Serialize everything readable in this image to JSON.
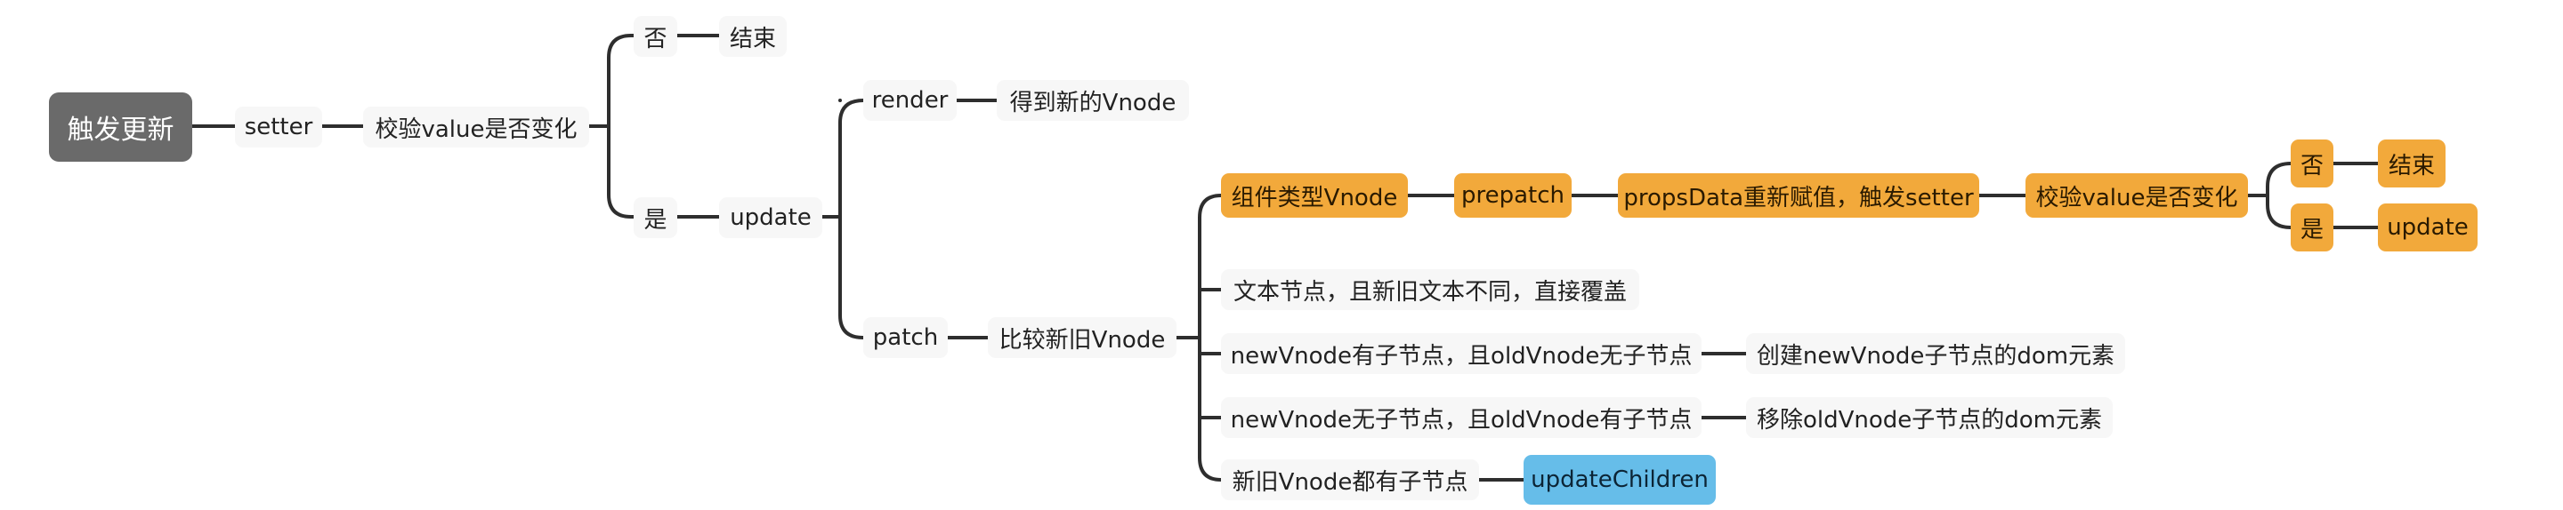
{
  "mindmap": {
    "root": "触发更新",
    "n_setter": "setter",
    "n_check1": "校验value是否变化",
    "n_no1": "否",
    "n_end1": "结束",
    "n_yes1": "是",
    "n_update1": "update",
    "n_render": "render",
    "n_newvnode": "得到新的Vnode",
    "n_patch": "patch",
    "n_compare": "比较新旧Vnode",
    "n_comp": "组件类型Vnode",
    "n_prepatch": "prepatch",
    "n_props": "propsData重新赋值，触发setter",
    "n_check2": "校验value是否变化",
    "n_no2": "否",
    "n_end2": "结束",
    "n_yes2": "是",
    "n_update2": "update",
    "n_text": "文本节点，且新旧文本不同，直接覆盖",
    "n_newhas": "newVnode有子节点，且oldVnode无子节点",
    "n_create": "创建newVnode子节点的dom元素",
    "n_newno": "newVnode无子节点，且oldVnode有子节点",
    "n_remove": "移除oldVnode子节点的dom元素",
    "n_both": "新旧Vnode都有子节点",
    "n_updchildren": "updateChildren"
  },
  "colors": {
    "root": "#6a6a6a",
    "highlight_orange": "#f2a93b",
    "highlight_blue": "#66bde9",
    "plain": "#f7f7f7",
    "line": "#333333"
  }
}
